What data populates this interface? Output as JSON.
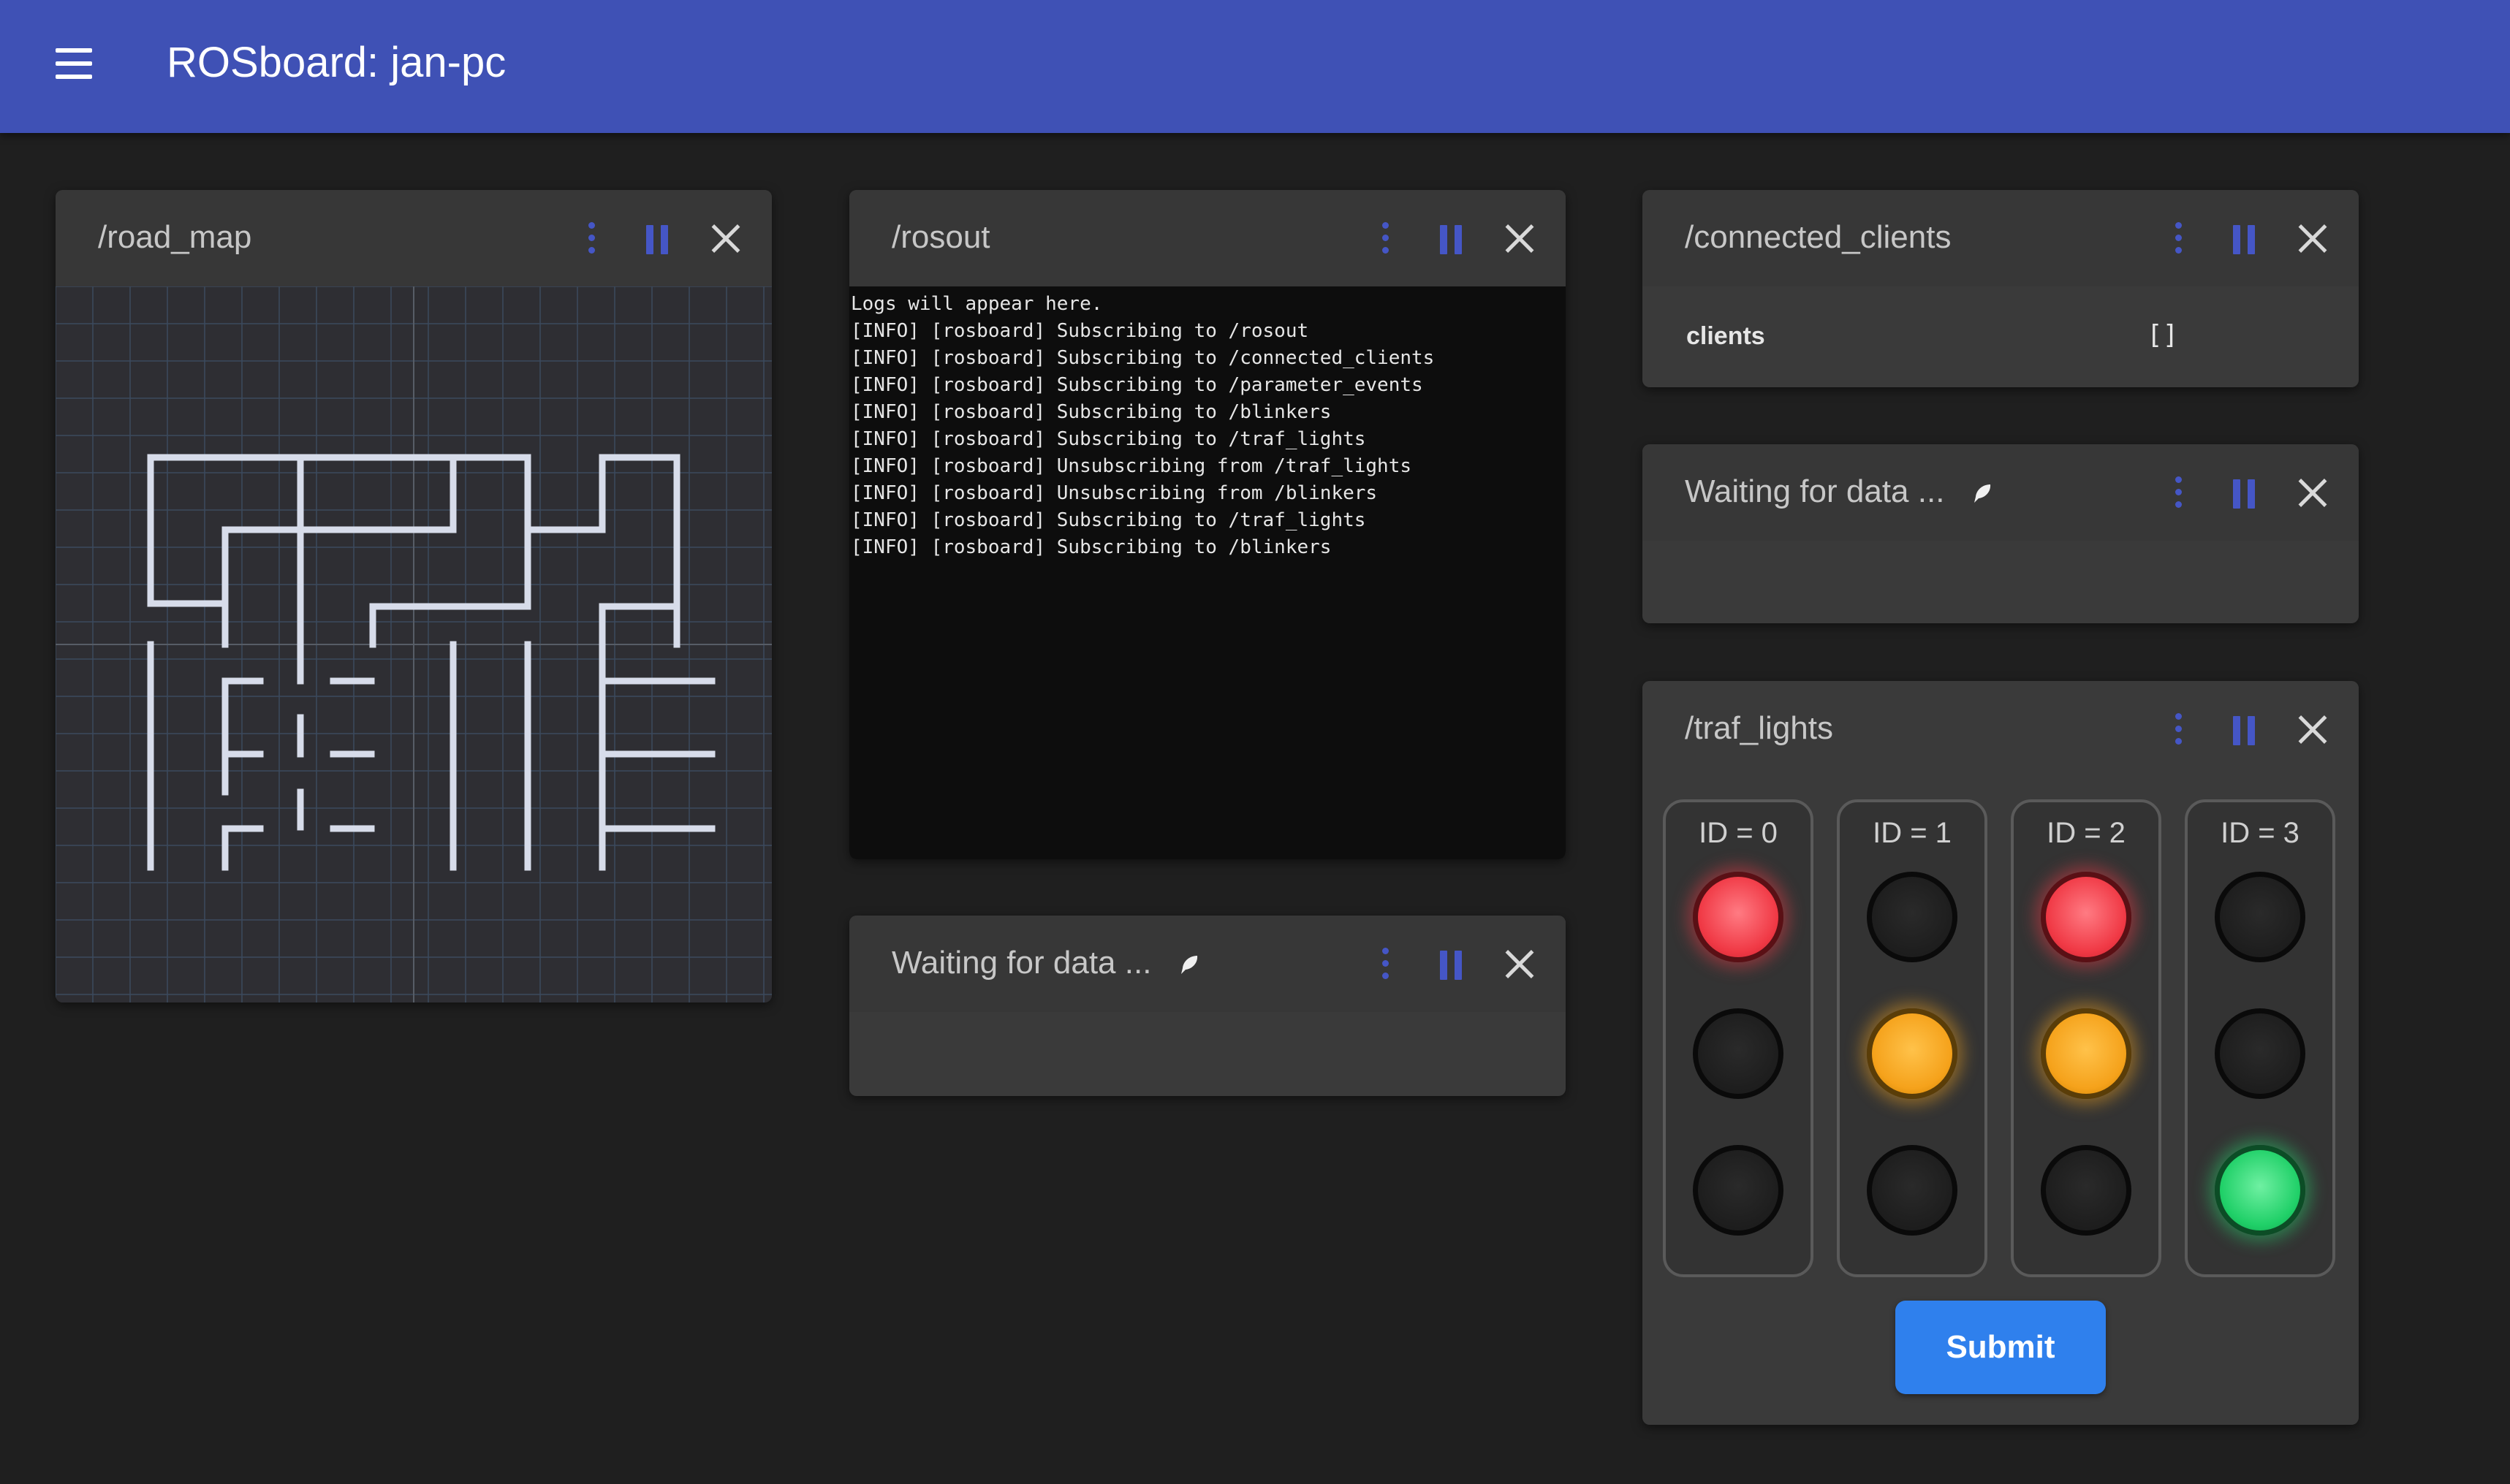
{
  "app": {
    "title": "ROSboard: jan-pc",
    "menu_icon": "hamburger-icon"
  },
  "colors": {
    "header": "#3f51b5",
    "accent": "#4556c6",
    "submit": "#2f80ed",
    "background": "#1f1f1f"
  },
  "cards": {
    "road_map": {
      "title": "/road_map"
    },
    "rosout": {
      "title": "/rosout",
      "log": "Logs will appear here.\n[INFO] [rosboard] Subscribing to /rosout\n[INFO] [rosboard] Subscribing to /connected_clients\n[INFO] [rosboard] Subscribing to /parameter_events\n[INFO] [rosboard] Subscribing to /blinkers\n[INFO] [rosboard] Subscribing to /traf_lights\n[INFO] [rosboard] Unsubscribing from /traf_lights\n[INFO] [rosboard] Unsubscribing from /blinkers\n[INFO] [rosboard] Subscribing to /traf_lights\n[INFO] [rosboard] Subscribing to /blinkers"
    },
    "waiting_middle": {
      "title": "Waiting for data ..."
    },
    "connected_clients": {
      "title": "/connected_clients",
      "key": "clients",
      "value": "[]"
    },
    "waiting_right": {
      "title": "Waiting for data ..."
    },
    "traf_lights": {
      "title": "/traf_lights",
      "lights": [
        {
          "label": "ID = 0",
          "red": true,
          "amber": false,
          "green": false
        },
        {
          "label": "ID = 1",
          "red": false,
          "amber": true,
          "green": false
        },
        {
          "label": "ID = 2",
          "red": true,
          "amber": true,
          "green": false
        },
        {
          "label": "ID = 3",
          "red": false,
          "amber": false,
          "green": true
        }
      ],
      "submit_label": "Submit"
    }
  }
}
